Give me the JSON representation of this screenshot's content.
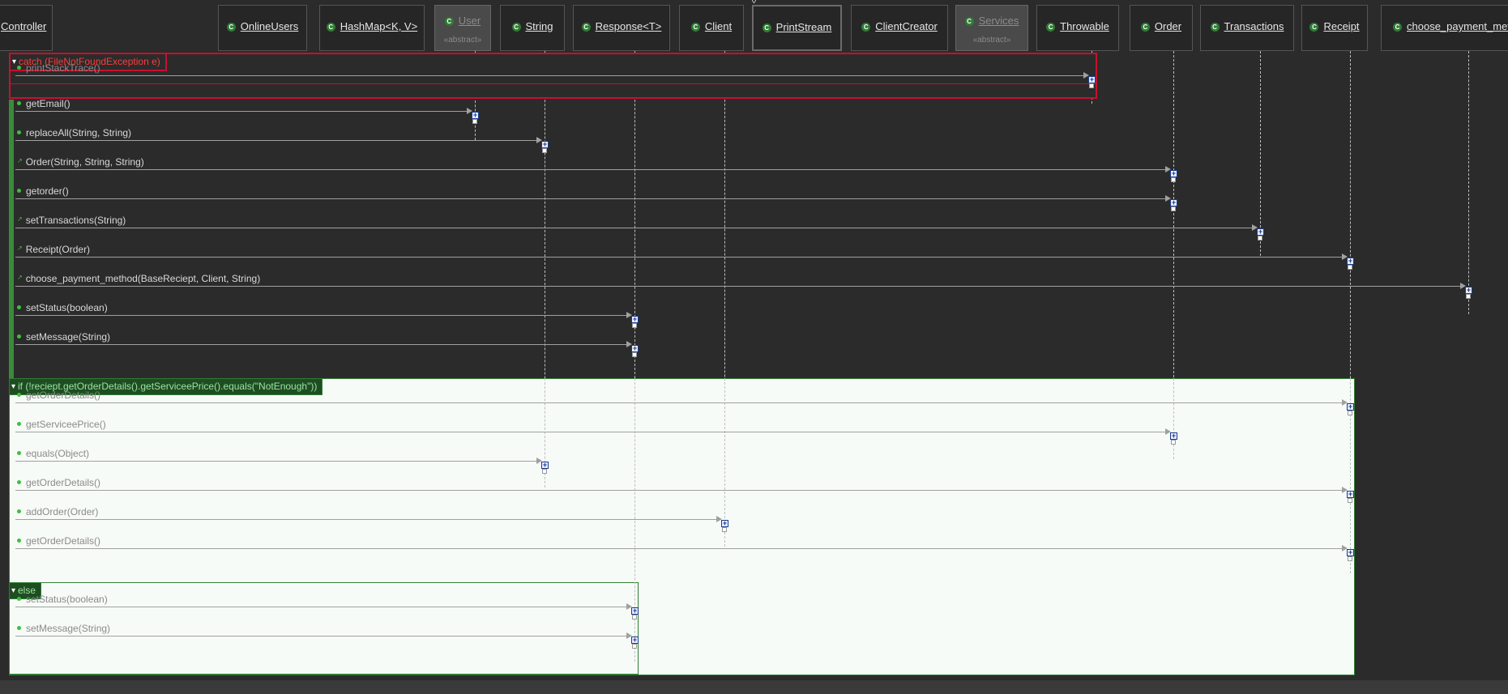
{
  "lifelines": [
    {
      "id": "controller",
      "label": "Controller"
    },
    {
      "id": "onlineusers",
      "label": "OnlineUsers"
    },
    {
      "id": "hashmap",
      "label": "HashMap<K, V>"
    },
    {
      "id": "user",
      "label": "User",
      "stereotype": "«abstract»"
    },
    {
      "id": "string",
      "label": "String"
    },
    {
      "id": "response",
      "label": "Response<T>"
    },
    {
      "id": "client",
      "label": "Client"
    },
    {
      "id": "printstream",
      "label": "PrintStream"
    },
    {
      "id": "clientcreator",
      "label": "ClientCreator"
    },
    {
      "id": "services",
      "label": "Services",
      "stereotype": "«abstract»"
    },
    {
      "id": "throwable",
      "label": "Throwable"
    },
    {
      "id": "order",
      "label": "Order"
    },
    {
      "id": "transactions",
      "label": "Transactions"
    },
    {
      "id": "receipt",
      "label": "Receipt"
    },
    {
      "id": "choose",
      "label": "choose_payment_meth"
    }
  ],
  "fragments": {
    "catch": "catch (FileNotFoundException e)",
    "if": "if (!reciept.getOrderDetails().getServiceePrice().equals(\"NotEnough\"))",
    "else": "else"
  },
  "messages": [
    {
      "label": "printStackTrace()",
      "target": "throwable",
      "kind": "method",
      "region": "catch"
    },
    {
      "label": "getEmail()",
      "target": "user",
      "kind": "method",
      "region": "main"
    },
    {
      "label": "replaceAll(String, String)",
      "target": "string",
      "kind": "method",
      "region": "main"
    },
    {
      "label": "Order(String, String, String)",
      "target": "order",
      "kind": "constructor",
      "region": "main"
    },
    {
      "label": "getorder()",
      "target": "order",
      "kind": "method",
      "region": "main"
    },
    {
      "label": "setTransactions(String)",
      "target": "transactions",
      "kind": "constructor",
      "region": "main"
    },
    {
      "label": "Receipt(Order)",
      "target": "receipt",
      "kind": "constructor",
      "region": "main"
    },
    {
      "label": "choose_payment_method(BaseReciept, Client, String)",
      "target": "choose",
      "kind": "constructor",
      "region": "main"
    },
    {
      "label": "setStatus(boolean)",
      "target": "response",
      "kind": "method",
      "region": "main"
    },
    {
      "label": "setMessage(String)",
      "target": "response",
      "kind": "method",
      "region": "main"
    },
    {
      "label": "getOrderDetails()",
      "target": "receipt",
      "kind": "method",
      "region": "if"
    },
    {
      "label": "getServiceePrice()",
      "target": "order",
      "kind": "method",
      "region": "if"
    },
    {
      "label": "equals(Object)",
      "target": "string",
      "kind": "method",
      "region": "if"
    },
    {
      "label": "getOrderDetails()",
      "target": "receipt",
      "kind": "method",
      "region": "if"
    },
    {
      "label": "addOrder(Order)",
      "target": "client",
      "kind": "method",
      "region": "if"
    },
    {
      "label": "getOrderDetails()",
      "target": "receipt",
      "kind": "method",
      "region": "if"
    },
    {
      "label": "setStatus(boolean)",
      "target": "response",
      "kind": "method",
      "region": "else"
    },
    {
      "label": "setMessage(String)",
      "target": "response",
      "kind": "method",
      "region": "else"
    }
  ],
  "colors": {
    "background": "#2b2b2b",
    "catch_border": "#c8102e",
    "fragment_border": "#2e7d32",
    "class_icon": "#2e7d32",
    "activation_border": "#1a3c8c"
  },
  "icons": {
    "class": "class-c-icon",
    "method": "public-method-dot-icon",
    "constructor": "constructor-icon"
  }
}
